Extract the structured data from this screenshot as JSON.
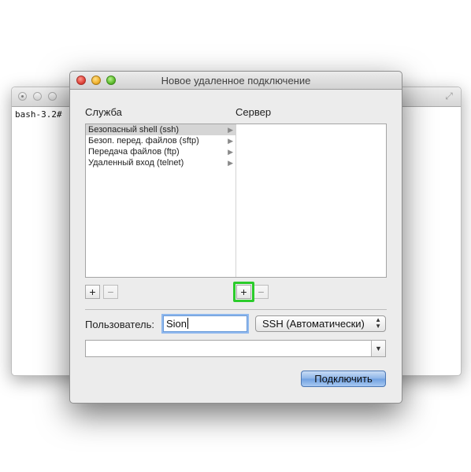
{
  "terminal": {
    "prompt": "bash-3.2#",
    "resize_glyph": "⤢"
  },
  "dialog": {
    "title": "Новое удаленное подключение",
    "service_label": "Служба",
    "server_label": "Сервер",
    "services": [
      {
        "label": "Безопасный shell (ssh)",
        "selected": true
      },
      {
        "label": "Безоп. перед. файлов (sftp)",
        "selected": false
      },
      {
        "label": "Передача файлов (ftp)",
        "selected": false
      },
      {
        "label": "Удаленный вход (telnet)",
        "selected": false
      }
    ],
    "row_arrow": "▶",
    "servers": [],
    "add_glyph": "+",
    "remove_glyph": "−",
    "user_label": "Пользователь:",
    "user_value": "Sion",
    "protocol_selected": "SSH (Автоматически)",
    "updown_glyph": "▲▼",
    "command_value": "",
    "dropdown_glyph": "▼",
    "connect_label": "Подключить",
    "highlight_color": "#2bcc2b"
  }
}
